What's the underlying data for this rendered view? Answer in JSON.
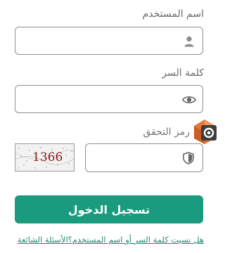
{
  "username": {
    "label": "اسم المستخدم",
    "value": "",
    "icon": "user-icon"
  },
  "password": {
    "label": "كلمة السر",
    "value": "",
    "icon": "eye-icon"
  },
  "captcha": {
    "label": "رمز التحقق",
    "image_text": "1366",
    "value": "",
    "icon": "shield-icon",
    "refresh_icon": "refresh-badge-icon"
  },
  "login_button": {
    "label": "تسجيل الدخول",
    "color": "#1a9a7f"
  },
  "links": {
    "forgot": "هل نسيت كلمة السر أو اسم المستخدم؟",
    "faq": "الأسئلة الشائعة"
  }
}
